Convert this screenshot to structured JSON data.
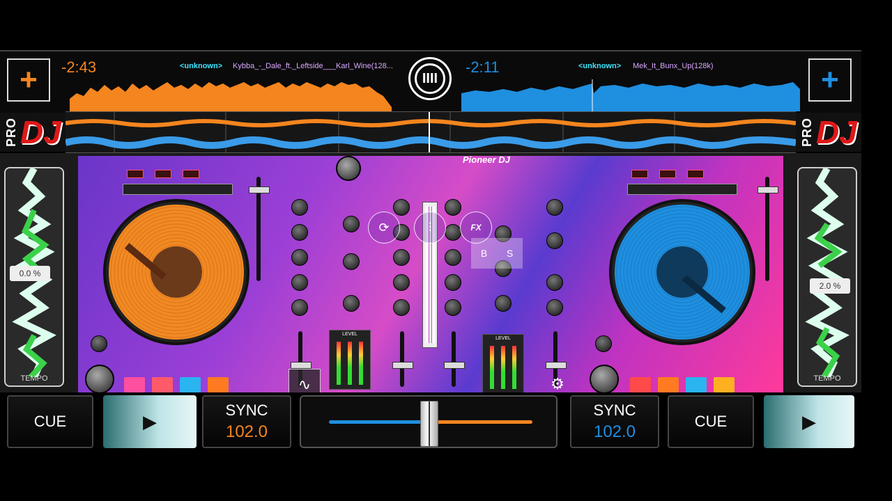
{
  "deck_a": {
    "add_label": "+",
    "time_remaining": "-2:43",
    "artist": "<unknown>",
    "track": "Kybba_-_Dale_ft._Leftside___Karl_Wine(128...",
    "pitch": "0.0 %",
    "tempo_label": "TEMPO",
    "cue_label": "CUE",
    "play_icon": "▶",
    "sync_label": "SYNC",
    "bpm": "102.0",
    "color": "#f5851f"
  },
  "deck_b": {
    "add_label": "+",
    "time_remaining": "-2:11",
    "artist": "<unknown>",
    "track": "Mek_It_Bunx_Up(128k)",
    "pitch": "2.0 %",
    "tempo_label": "TEMPO",
    "cue_label": "CUE",
    "play_icon": "▶",
    "sync_label": "SYNC",
    "bpm": "102.0",
    "color": "#1f8fe0"
  },
  "branding": {
    "pro": "PRO",
    "dj": "DJ",
    "controller_brand": "Pioneer DJ"
  },
  "mixer": {
    "fx_label": "FX",
    "b_label": "B",
    "s_label": "S",
    "level_label": "LEVEL"
  },
  "crossfader_value": 0.5,
  "icons": [
    "menu-logo-icon",
    "sync-loop-icon",
    "mixer-sliders-icon",
    "fx-icon",
    "waveform-icon",
    "gear-icon",
    "grid-icon",
    "play-icon"
  ]
}
